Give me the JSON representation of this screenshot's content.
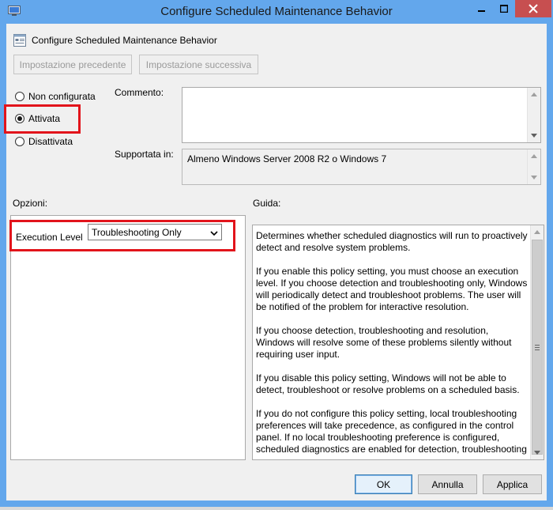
{
  "window": {
    "title": "Configure Scheduled Maintenance Behavior"
  },
  "header": {
    "title": "Configure Scheduled Maintenance Behavior"
  },
  "nav": {
    "prev_label": "Impostazione precedente",
    "next_label": "Impostazione successiva"
  },
  "state": {
    "options": [
      {
        "label": "Non configurata",
        "selected": false
      },
      {
        "label": "Attivata",
        "selected": true
      },
      {
        "label": "Disattivata",
        "selected": false
      }
    ]
  },
  "comment": {
    "label": "Commento:",
    "value": ""
  },
  "supported": {
    "label": "Supportata in:",
    "value": "Almeno Windows Server 2008 R2 o Windows 7"
  },
  "options_section": {
    "label": "Opzioni:",
    "execution_level_label": "Execution Level",
    "execution_level_value": "Troubleshooting Only"
  },
  "help_section": {
    "label": "Guida:",
    "paragraphs": [
      "Determines whether scheduled diagnostics will run to proactively detect and resolve system problems.",
      "If you enable this policy setting, you must choose an execution level.  If you choose detection and troubleshooting only, Windows will periodically detect and troubleshoot problems. The user will be notified of the problem for interactive resolution.",
      "If you choose detection, troubleshooting and resolution, Windows will resolve some of these problems silently without requiring user input.",
      "If you disable this policy setting, Windows will not be able to detect, troubleshoot or resolve problems on a scheduled basis.",
      "If you do not configure this policy setting, local troubleshooting preferences will take precedence, as configured in the control panel.  If no local troubleshooting preference is configured, scheduled diagnostics are enabled for detection, troubleshooting"
    ]
  },
  "buttons": {
    "ok": "OK",
    "cancel": "Annulla",
    "apply": "Applica"
  },
  "colors": {
    "titlebar": "#63a7ec",
    "close_button": "#c74f50",
    "highlight_box": "#e2141b",
    "dialog_bg": "#f0f0f0"
  }
}
